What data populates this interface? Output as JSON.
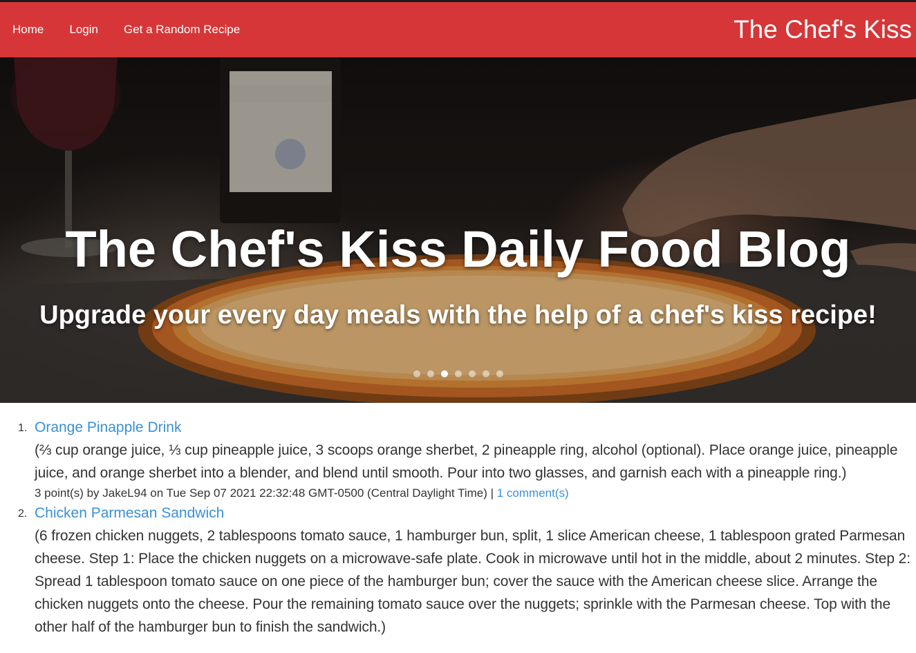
{
  "nav": {
    "links": [
      "Home",
      "Login",
      "Get a Random Recipe"
    ],
    "brand": "The Chef's Kiss"
  },
  "hero": {
    "title": "The Chef's Kiss Daily Food Blog",
    "subtitle": "Upgrade your every day meals with the help of a chef's kiss recipe!",
    "slide_count": 7,
    "active_slide": 3
  },
  "recipes": [
    {
      "number": "1.",
      "title": "Orange Pinapple Drink",
      "description": "(⅔ cup orange juice, ⅓ cup pineapple juice, 3 scoops orange sherbet, 2 pineapple ring, alcohol (optional). Place orange juice, pineapple juice, and orange sherbet into a blender, and blend until smooth. Pour into two glasses, and garnish each with a pineapple ring.)",
      "meta": "3 point(s) by JakeL94 on Tue Sep 07 2021 22:32:48 GMT-0500 (Central Daylight Time) |",
      "comments": "1 comment(s)"
    },
    {
      "number": "2.",
      "title": "Chicken Parmesan Sandwich",
      "description": "(6 frozen chicken nuggets, 2 tablespoons tomato sauce, 1 hamburger bun, split, 1 slice American cheese, 1 tablespoon grated Parmesan cheese. Step 1: Place the chicken nuggets on a microwave-safe plate. Cook in microwave until hot in the middle, about 2 minutes. Step 2: Spread 1 tablespoon tomato sauce on one piece of the hamburger bun; cover the sauce with the American cheese slice. Arrange the chicken nuggets onto the cheese. Pour the remaining tomato sauce over the nuggets; sprinkle with the Parmesan cheese. Top with the other half of the hamburger bun to finish the sandwich.)"
    }
  ]
}
